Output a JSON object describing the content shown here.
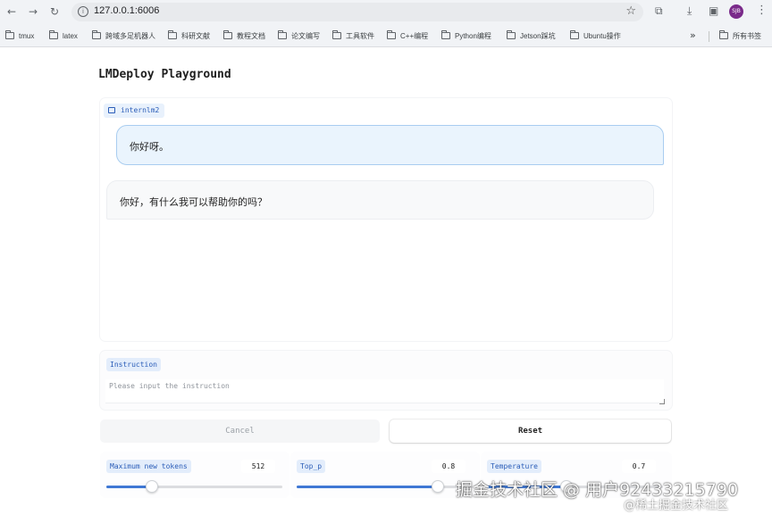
{
  "browser": {
    "url": "127.0.0.1:6006",
    "profile_initials": "SJB",
    "bookmarks": [
      "tmux",
      "latex",
      "跨域多足机器人",
      "科研文献",
      "教程文档",
      "论文编写",
      "工具软件",
      "C++编程",
      "Python编程",
      "Jetson踩坑",
      "Ubuntu操作"
    ],
    "bookmarks_more": "»",
    "all_bookmarks": "所有书签"
  },
  "app": {
    "title": "LMDeploy Playground",
    "chat": {
      "model_label": "internlm2",
      "messages": [
        {
          "role": "user",
          "text": "你好呀。"
        },
        {
          "role": "assistant",
          "text": "你好，有什么我可以帮助你的吗？"
        }
      ]
    },
    "instruction": {
      "label": "Instruction",
      "placeholder": "Please input the instruction",
      "value": ""
    },
    "buttons": {
      "cancel": "Cancel",
      "reset": "Reset"
    },
    "sliders": [
      {
        "label": "Maximum new tokens",
        "value": "512",
        "fraction": 0.26
      },
      {
        "label": "Top_p",
        "value": "0.8",
        "fraction": 0.8
      },
      {
        "label": "Temperature",
        "value": "0.7",
        "fraction": 0.45
      }
    ],
    "colors": {
      "accent": "#3f78d4",
      "label_bg": "#e3edfb",
      "label_text": "#2b5db8",
      "user_bubble": "#eaf4fd",
      "user_bubble_border": "#a9cdf0"
    }
  },
  "watermark": {
    "main": "掘金技术社区 @ 用户92433215790",
    "sub": "@稀土掘金技术社区"
  }
}
